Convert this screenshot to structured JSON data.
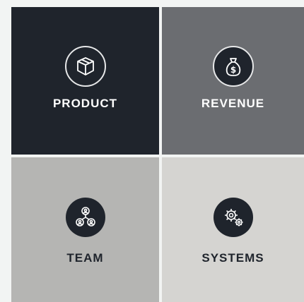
{
  "tiles": [
    {
      "label": "PRODUCT",
      "icon": "box-icon",
      "background": "#1f242c"
    },
    {
      "label": "REVENUE",
      "icon": "money-bag-icon",
      "background": "#6b6d71"
    },
    {
      "label": "TEAM",
      "icon": "team-icon",
      "background": "#b5b5b3"
    },
    {
      "label": "SYSTEMS",
      "icon": "gears-icon",
      "background": "#d5d4d1"
    }
  ]
}
